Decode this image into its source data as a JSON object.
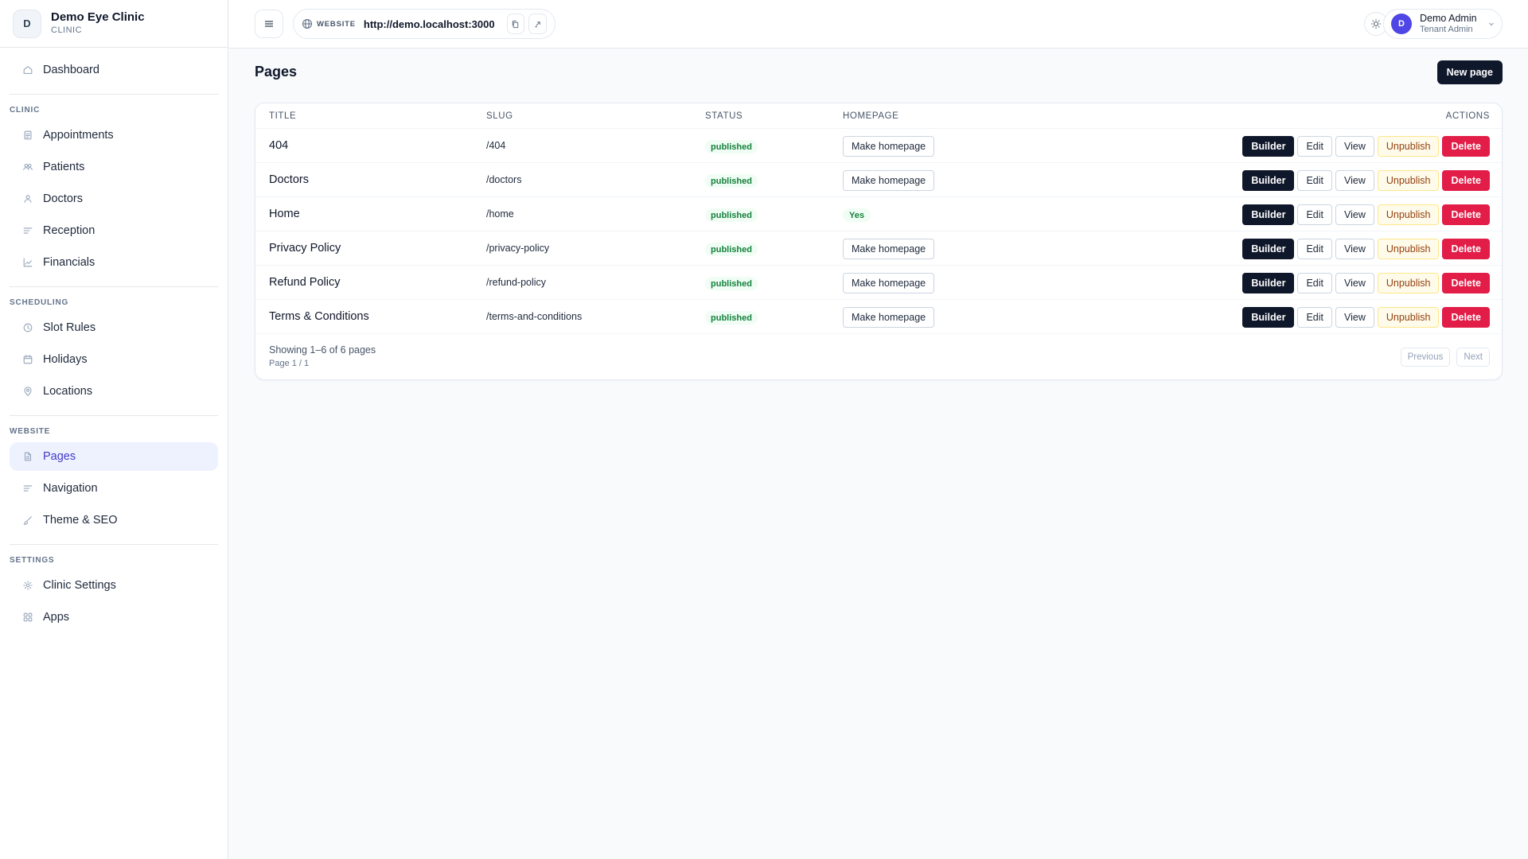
{
  "brand": {
    "initial": "D",
    "name": "Demo Eye Clinic",
    "subtitle": "CLINIC"
  },
  "sidebar": {
    "dashboard": {
      "label": "Dashboard",
      "icon": "home-icon"
    },
    "sections": [
      {
        "label": "CLINIC",
        "items": [
          {
            "label": "Appointments",
            "icon": "list-icon"
          },
          {
            "label": "Patients",
            "icon": "users-icon"
          },
          {
            "label": "Doctors",
            "icon": "user-icon"
          },
          {
            "label": "Reception",
            "icon": "lines-icon"
          },
          {
            "label": "Financials",
            "icon": "chart-icon"
          }
        ]
      },
      {
        "label": "SCHEDULING",
        "items": [
          {
            "label": "Slot Rules",
            "icon": "clock-icon"
          },
          {
            "label": "Holidays",
            "icon": "calendar-icon"
          },
          {
            "label": "Locations",
            "icon": "pin-icon"
          }
        ]
      },
      {
        "label": "WEBSITE",
        "items": [
          {
            "label": "Pages",
            "icon": "file-icon",
            "active": true
          },
          {
            "label": "Navigation",
            "icon": "lines-icon"
          },
          {
            "label": "Theme & SEO",
            "icon": "brush-icon"
          }
        ]
      },
      {
        "label": "SETTINGS",
        "items": [
          {
            "label": "Clinic Settings",
            "icon": "gear-icon"
          },
          {
            "label": "Apps",
            "icon": "grid-icon"
          }
        ]
      }
    ]
  },
  "topbar": {
    "website_label": "WEBSITE",
    "url": "http://demo.localhost:3000",
    "user": {
      "initial": "D",
      "name": "Demo Admin",
      "role": "Tenant Admin"
    }
  },
  "main": {
    "title": "Pages",
    "new_page_label": "New page",
    "columns": {
      "title": "TITLE",
      "slug": "SLUG",
      "status": "STATUS",
      "homepage": "HOMEPAGE",
      "actions": "ACTIONS"
    },
    "make_homepage_label": "Make homepage",
    "yes_label": "Yes",
    "action_labels": {
      "builder": "Builder",
      "edit": "Edit",
      "view": "View",
      "unpublish": "Unpublish",
      "delete": "Delete"
    },
    "rows": [
      {
        "title": "404",
        "slug": "/404",
        "status": "published",
        "homepage": false
      },
      {
        "title": "Doctors",
        "slug": "/doctors",
        "status": "published",
        "homepage": false
      },
      {
        "title": "Home",
        "slug": "/home",
        "status": "published",
        "homepage": true
      },
      {
        "title": "Privacy Policy",
        "slug": "/privacy-policy",
        "status": "published",
        "homepage": false
      },
      {
        "title": "Refund Policy",
        "slug": "/refund-policy",
        "status": "published",
        "homepage": false
      },
      {
        "title": "Terms & Conditions",
        "slug": "/terms-and-conditions",
        "status": "published",
        "homepage": false
      }
    ],
    "showing": "Showing 1–6 of 6 pages",
    "page_of": "Page 1 / 1",
    "previous_label": "Previous",
    "next_label": "Next"
  }
}
